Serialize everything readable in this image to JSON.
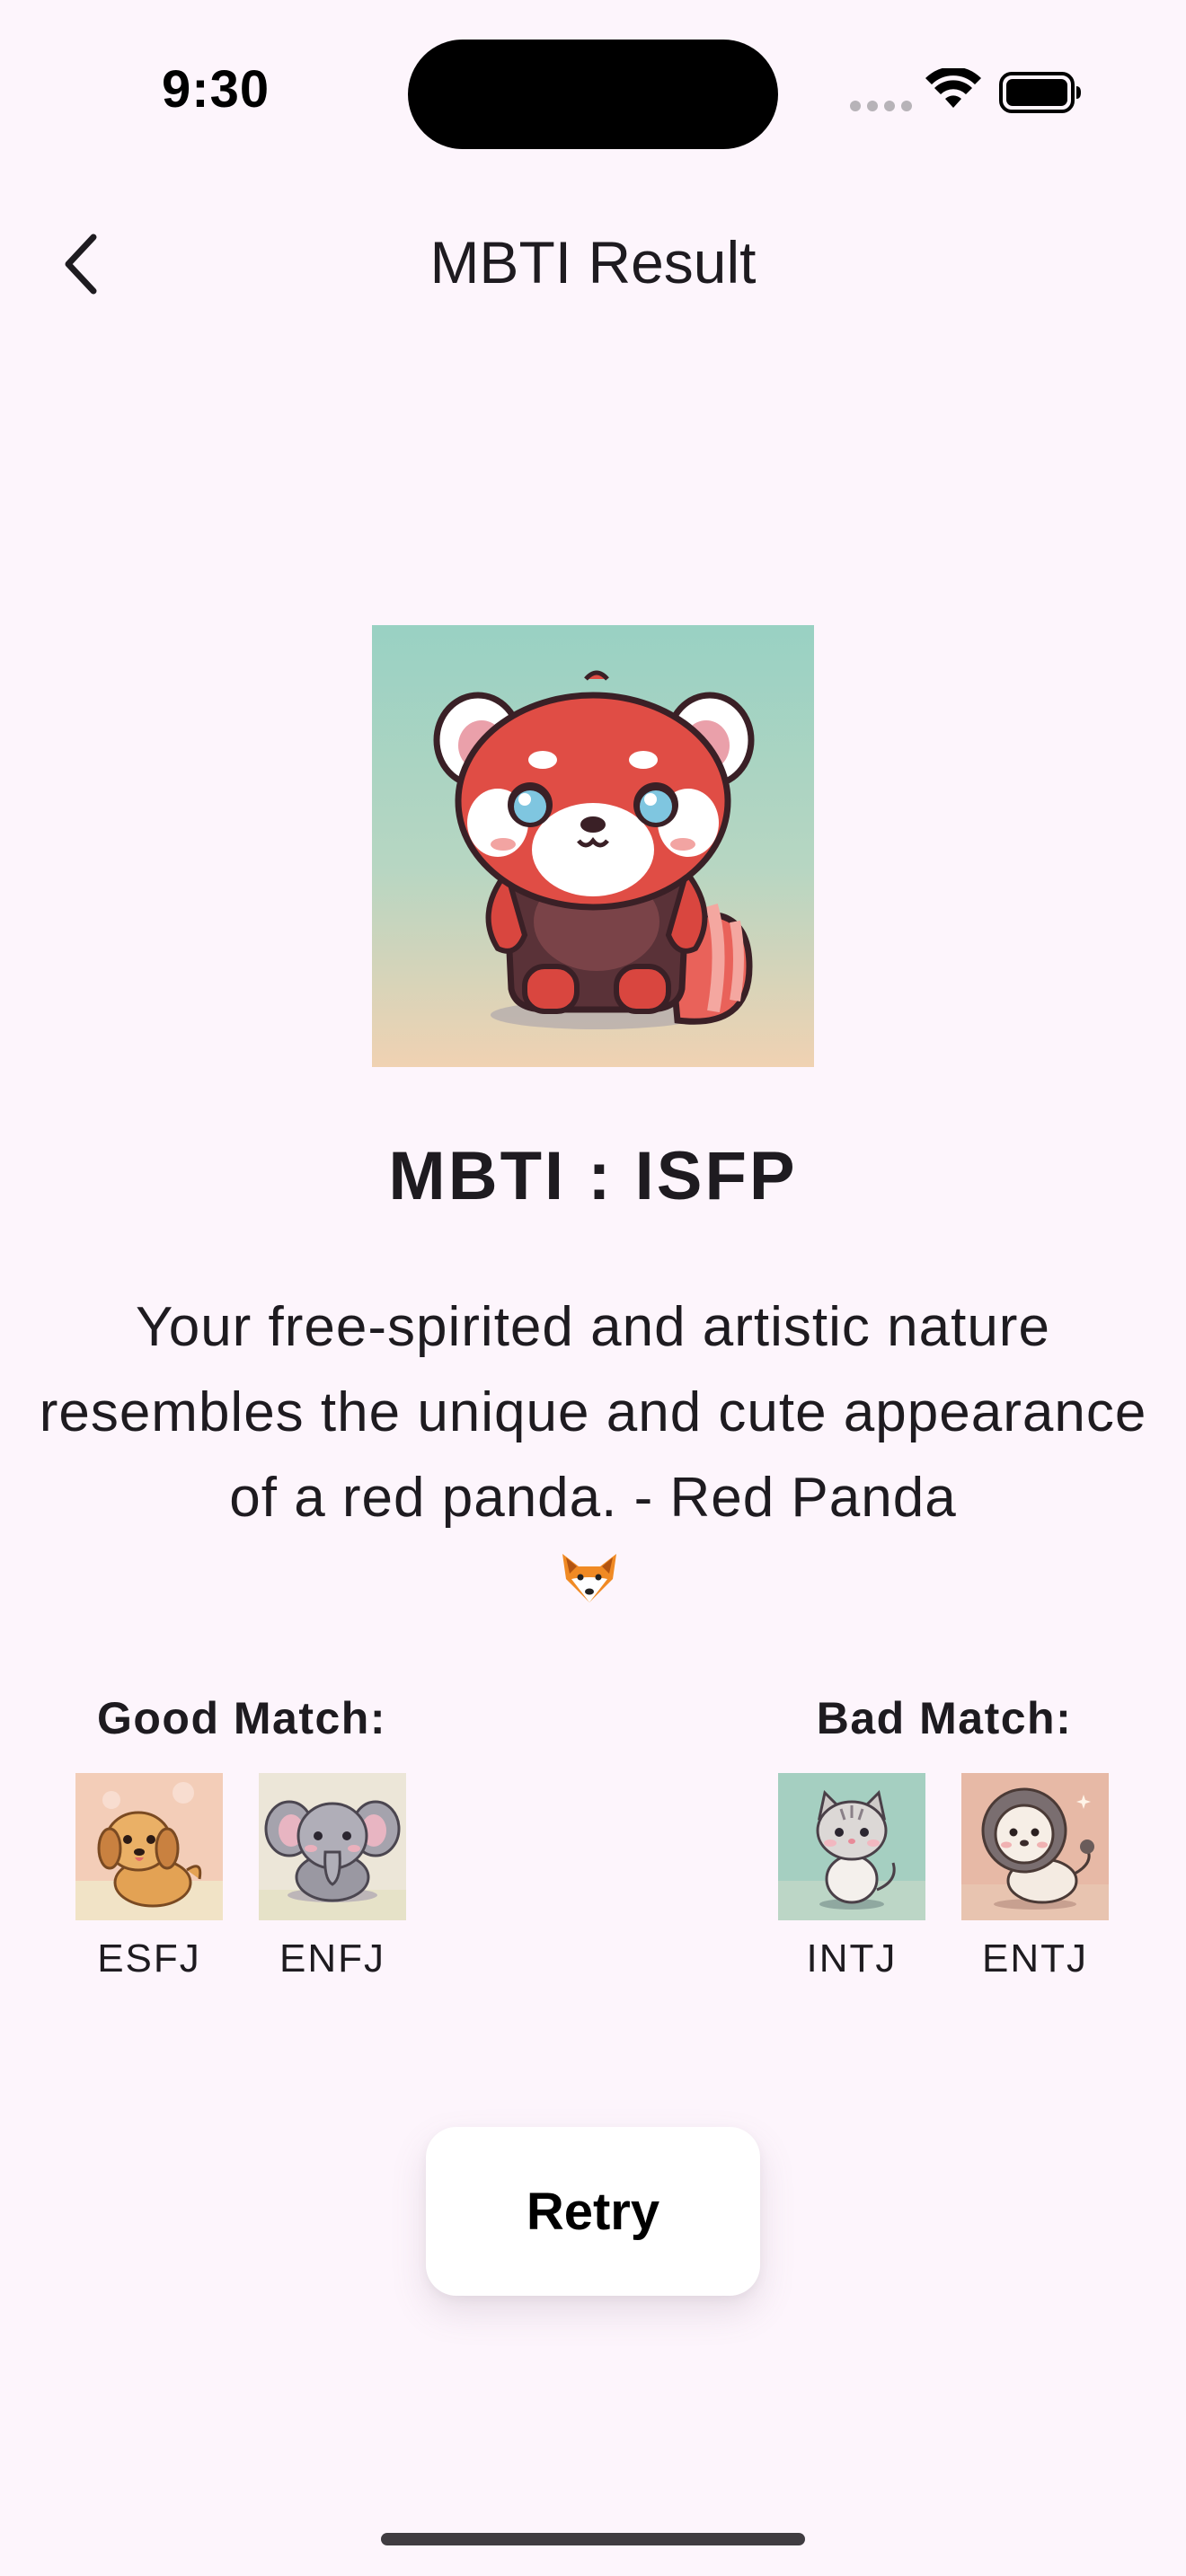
{
  "status_bar": {
    "time": "9:30"
  },
  "header": {
    "title": "MBTI Result",
    "back_icon": "chevron-left-icon"
  },
  "result": {
    "heading": "MBTI : ISFP",
    "description": "Your free-spirited and artistic nature resembles the unique and cute appearance of a red panda. - Red Panda",
    "emoji": "fox-face-emoji",
    "image": "red-panda-illustration"
  },
  "matches": {
    "good": {
      "heading": "Good Match:",
      "items": [
        {
          "label": "ESFJ",
          "image": "puppy-illustration"
        },
        {
          "label": "ENFJ",
          "image": "elephant-illustration"
        }
      ]
    },
    "bad": {
      "heading": "Bad Match:",
      "items": [
        {
          "label": "INTJ",
          "image": "cat-illustration"
        },
        {
          "label": "ENTJ",
          "image": "lion-illustration"
        }
      ]
    }
  },
  "actions": {
    "retry_label": "Retry"
  },
  "colors": {
    "background": "#fdf5fc",
    "text": "#1e1b20",
    "button": "#ffffff"
  }
}
